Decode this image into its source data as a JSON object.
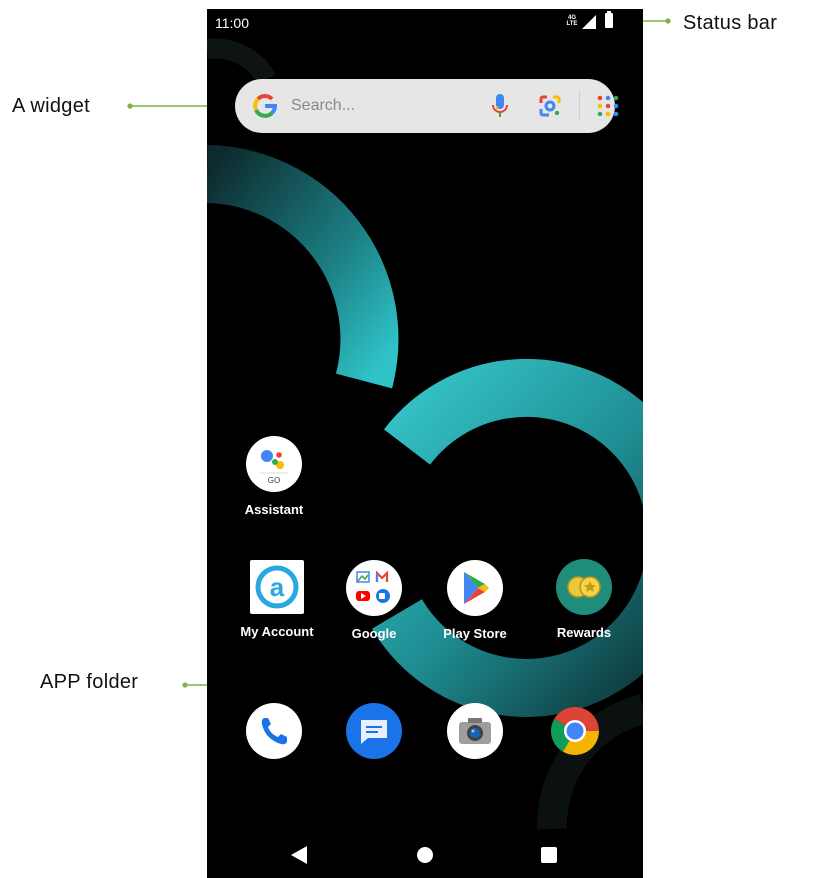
{
  "status_bar": {
    "time": "11:00",
    "network_type": "4G LTE",
    "icons": [
      "signal-icon",
      "battery-icon"
    ]
  },
  "search_widget": {
    "placeholder": "Search...",
    "icons": [
      "google-g-icon",
      "mic-icon",
      "google-lens-icon",
      "apps-grid-icon"
    ]
  },
  "home_apps": [
    {
      "label": "Assistant",
      "icon": "assistant-icon"
    },
    {
      "label": "My Account",
      "icon": "my-account-icon"
    },
    {
      "label": "Google",
      "icon": "google-folder-icon"
    },
    {
      "label": "Play Store",
      "icon": "play-store-icon"
    },
    {
      "label": "Rewards",
      "icon": "rewards-icon"
    }
  ],
  "dock_apps": [
    {
      "icon": "phone-icon"
    },
    {
      "icon": "messages-icon"
    },
    {
      "icon": "camera-icon"
    },
    {
      "icon": "chrome-icon"
    }
  ],
  "nav_bar": {
    "icons": [
      "back-icon",
      "home-icon",
      "recents-icon"
    ]
  },
  "annotations": {
    "status_bar": "Status bar",
    "widget": "A widget",
    "app_folder": "APP folder"
  },
  "colors": {
    "annotation_line": "#7cb342",
    "wallpaper_accent": "#2ab7bd",
    "background": "#000000"
  }
}
